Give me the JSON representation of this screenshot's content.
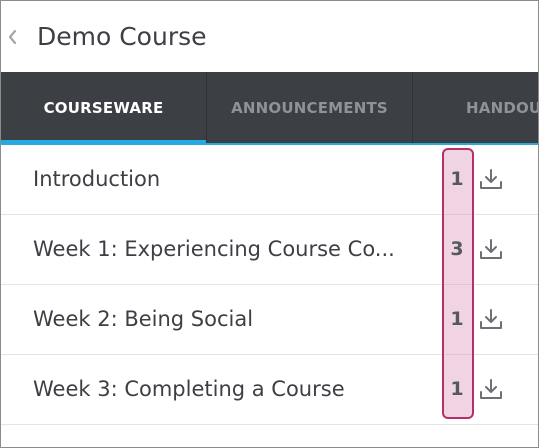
{
  "header": {
    "back_icon": "chevron-left-icon",
    "title": "Demo Course"
  },
  "tabs": [
    {
      "label": "COURSEWARE",
      "active": true
    },
    {
      "label": "ANNOUNCEMENTS",
      "active": false
    },
    {
      "label": "HANDOUTS",
      "active": false
    }
  ],
  "sections": [
    {
      "title": "Introduction",
      "count": "1",
      "icon": "download-icon"
    },
    {
      "title": "Week 1: Experiencing Course Co...",
      "count": "3",
      "icon": "download-icon"
    },
    {
      "title": "Week 2: Being Social",
      "count": "1",
      "icon": "download-icon"
    },
    {
      "title": "Week 3: Completing a Course",
      "count": "1",
      "icon": "download-icon"
    }
  ],
  "colors": {
    "tab_bar_background": "#3c3f44",
    "active_tab_indicator": "#28a8e0",
    "highlight_border": "#b3306a",
    "highlight_fill": "#dea0c3"
  }
}
